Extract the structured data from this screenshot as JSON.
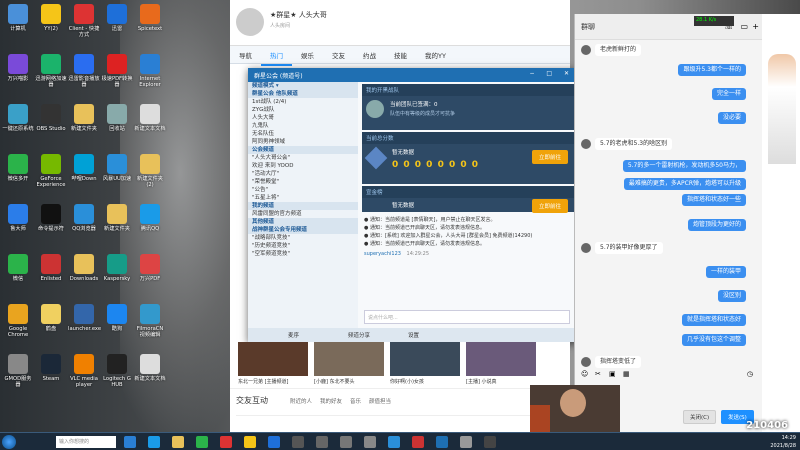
{
  "desktop_icons": [
    {
      "label": "计算机",
      "color": "#4a90d9"
    },
    {
      "label": "YY(2)",
      "color": "#f5c518"
    },
    {
      "label": "Client - 快捷方式",
      "color": "#d33"
    },
    {
      "label": "迅雷",
      "color": "#1e6fd9"
    },
    {
      "label": "Spicetext",
      "color": "#e86a1c"
    },
    {
      "label": "万兴喵影",
      "color": "#7a4ad9"
    },
    {
      "label": "迅游网络加速器",
      "color": "#1bb36b"
    },
    {
      "label": "迅雷影音播放器",
      "color": "#2a6df0"
    },
    {
      "label": "极速PDF转换器",
      "color": "#d22"
    },
    {
      "label": "Internet Explorer",
      "color": "#2a7fd4"
    },
    {
      "label": "一键还原系统",
      "color": "#3aa0c8"
    },
    {
      "label": "OBS Studio",
      "color": "#333"
    },
    {
      "label": "新建文件夹",
      "color": "#e8c15a"
    },
    {
      "label": "回收站",
      "color": "#8aa"
    },
    {
      "label": "新建文本文档",
      "color": "#ddd"
    },
    {
      "label": "微信多开",
      "color": "#2bb34a"
    },
    {
      "label": "GeForce Experience",
      "color": "#76b900"
    },
    {
      "label": "哔哩Down",
      "color": "#00a1d6"
    },
    {
      "label": "风暴UU加速",
      "color": "#2a8fd9"
    },
    {
      "label": "新建文件夹 (2)",
      "color": "#e8c15a"
    },
    {
      "label": "鲁大师",
      "color": "#2b7de9"
    },
    {
      "label": "命令提示符",
      "color": "#111"
    },
    {
      "label": "QQ浏览器",
      "color": "#2a8fd9"
    },
    {
      "label": "新建文件夹",
      "color": "#e8c15a"
    },
    {
      "label": "腾讯QQ",
      "color": "#1a9be8"
    },
    {
      "label": "微信",
      "color": "#2bb34a"
    },
    {
      "label": "Enlisted",
      "color": "#c33"
    },
    {
      "label": "Downloads",
      "color": "#e8c15a"
    },
    {
      "label": "Kaspersky",
      "color": "#169c88"
    },
    {
      "label": "万兴PDF",
      "color": "#d44"
    },
    {
      "label": "Google Chrome",
      "color": "#e9a41f"
    },
    {
      "label": "鹤盘",
      "color": "#f0d060"
    },
    {
      "label": "launcher.exe",
      "color": "#3366aa"
    },
    {
      "label": "酷狗",
      "color": "#1c86f0"
    },
    {
      "label": "FilmoraCN 视频编辑",
      "color": "#39c"
    },
    {
      "label": "GMOD服务器",
      "color": "#888"
    },
    {
      "label": "Steam",
      "color": "#1b2838"
    },
    {
      "label": "VLC media player",
      "color": "#f08000"
    },
    {
      "label": "Logitech G HUB",
      "color": "#222"
    },
    {
      "label": "新建文本文档",
      "color": "#ddd"
    }
  ],
  "qq_window": {
    "nickname": "★群星★ 人头大哥",
    "nav_tabs": [
      "导航",
      "热门",
      "娱乐",
      "交友",
      "约战",
      "技能",
      "我的YY"
    ],
    "active_tab": 1
  },
  "yy_window": {
    "title": "群星公会 (频道号)",
    "left_rows": [
      {
        "text": "频道模式 ▾",
        "hdr": true
      },
      {
        "text": "群星公会  他队频道",
        "hdr": true
      },
      {
        "text": "1st战队 (2/4)"
      },
      {
        "text": "ZYG战队"
      },
      {
        "text": "人头大哥"
      },
      {
        "text": "九鬼队"
      },
      {
        "text": "无名队伍"
      },
      {
        "text": "阿同男神领域"
      },
      {
        "text": "公会频道",
        "hdr": true
      },
      {
        "text": "\"人头大哥公会\""
      },
      {
        "text": "欢迎 来到 YOOD"
      },
      {
        "text": "\"活动大厅\""
      },
      {
        "text": "\"荣誉殿堂\""
      },
      {
        "text": "\"公告\""
      },
      {
        "text": "\"五星上将\""
      },
      {
        "text": "我的频道",
        "hdr": true
      },
      {
        "text": "  风雷同盟的官方频道"
      },
      {
        "text": "其他频道",
        "hdr": true
      },
      {
        "text": "战神群星公会专用频道",
        "hdr": true
      },
      {
        "text": "\"战略部队竞技\""
      },
      {
        "text": "\"历史频道竞技\""
      },
      {
        "text": "\"空军频道竞技\""
      }
    ],
    "panel1_header": "我的开黑战队",
    "panel1_text": "当前团队已签满：0",
    "panel1_sub": "队伍中有等级的成员才可抗争",
    "panel2_header": "当前总分数",
    "panel2_rank": "暂无数据",
    "panel2_score": "0 0 0 0 0 0 0 0",
    "panel3_header": "宣金榜",
    "panel3_text": "暂无数据",
    "join_btn": "立即前往",
    "messages": [
      "● 通知：当前频道是 [表情聊天]，用户禁止在聊天区发言。",
      "● 通知：当前频道已开启聊天区，请勿发表违规信息。",
      "● 通知：[系统] 欢迎加入群星公会，人头大哥 [群星会员] 免费频道(14290)",
      "● 通知：当前频道已开启聊天区，请勿发表违规信息。"
    ],
    "user_tag": "superyachi123",
    "time": "14:29:25",
    "input_placeholder": "说点什么吧...",
    "bottom": [
      "麦序",
      "频道分享",
      "设置"
    ]
  },
  "strip": [
    {
      "cap": "东北一兄弟 [主播频道]"
    },
    {
      "cap": "[小鹿] 东北不要头"
    },
    {
      "cap": "你好啊(小)女孩"
    },
    {
      "cap": "[主播] 小说真"
    }
  ],
  "friend_section": {
    "title": "交友互动",
    "tabs": [
      "附近的人",
      "我的好友",
      "音乐",
      "颜值担当"
    ]
  },
  "chat": {
    "title": "群聊",
    "messages": [
      {
        "dir": "in",
        "text": "老虎新鲜打的"
      },
      {
        "dir": "out",
        "text": "跟级升5.3都个一样的"
      },
      {
        "dir": "out",
        "text": "完全一样"
      },
      {
        "dir": "out",
        "text": "没必要"
      },
      {
        "dir": "in",
        "text": "5.7的老虎和5.3的啥区别"
      },
      {
        "dir": "out",
        "text": "5.7的多一个雷射机枪，发动机多50马力，"
      },
      {
        "dir": "out",
        "text": "最难搞的更贵，多APCR弹，炮塔可以升级"
      },
      {
        "dir": "out",
        "text": "指挥塔和状态好一些"
      },
      {
        "dir": "out",
        "text": "炮管顶段为更好的"
      },
      {
        "dir": "in",
        "text": "5.7的装甲好像更厚了"
      },
      {
        "dir": "out",
        "text": "一样的装甲"
      },
      {
        "dir": "out",
        "text": "没区别"
      },
      {
        "dir": "out",
        "text": "就是指挥塔和状态好"
      },
      {
        "dir": "out",
        "text": "几乎没有包这个调整"
      },
      {
        "dir": "in",
        "text": "指挥塔变低了"
      }
    ],
    "close_btn": "关闭(C)",
    "send_btn": "发送(S)"
  },
  "net_speed": "28.1 K/s",
  "watermark": "210406",
  "taskbar": {
    "search_placeholder": "输入你想搜的",
    "time": "14:29",
    "date": "2021/8/28"
  }
}
